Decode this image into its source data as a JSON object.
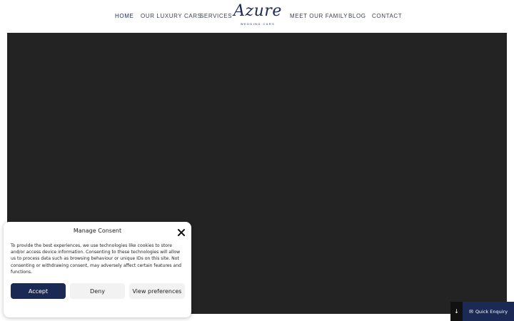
{
  "nav": {
    "home": "HOME",
    "cars": "OUR LUXURY CARS",
    "services": "SERVICES",
    "family": "MEET OUR FAMILY",
    "blog": "BLOG",
    "contact": "CONTACT"
  },
  "logo": {
    "word": "Azure",
    "tagline": "WEDDING CARS"
  },
  "consent": {
    "title": "Manage Consent",
    "body": "To provide the best experiences, we use technologies like cookies to store and/or access device information. Consenting to these technologies will allow us to process data such as browsing behaviour or unique IDs on this site. Not consenting or withdrawing consent, may adversely affect certain features and functions.",
    "accept": "Accept",
    "deny": "Deny",
    "prefs": "View preferences"
  },
  "floating": {
    "arrow": "↓",
    "enquiry": "Quick Enquiry"
  },
  "colors": {
    "brand": "#1b2a55",
    "hero": "#232323"
  }
}
